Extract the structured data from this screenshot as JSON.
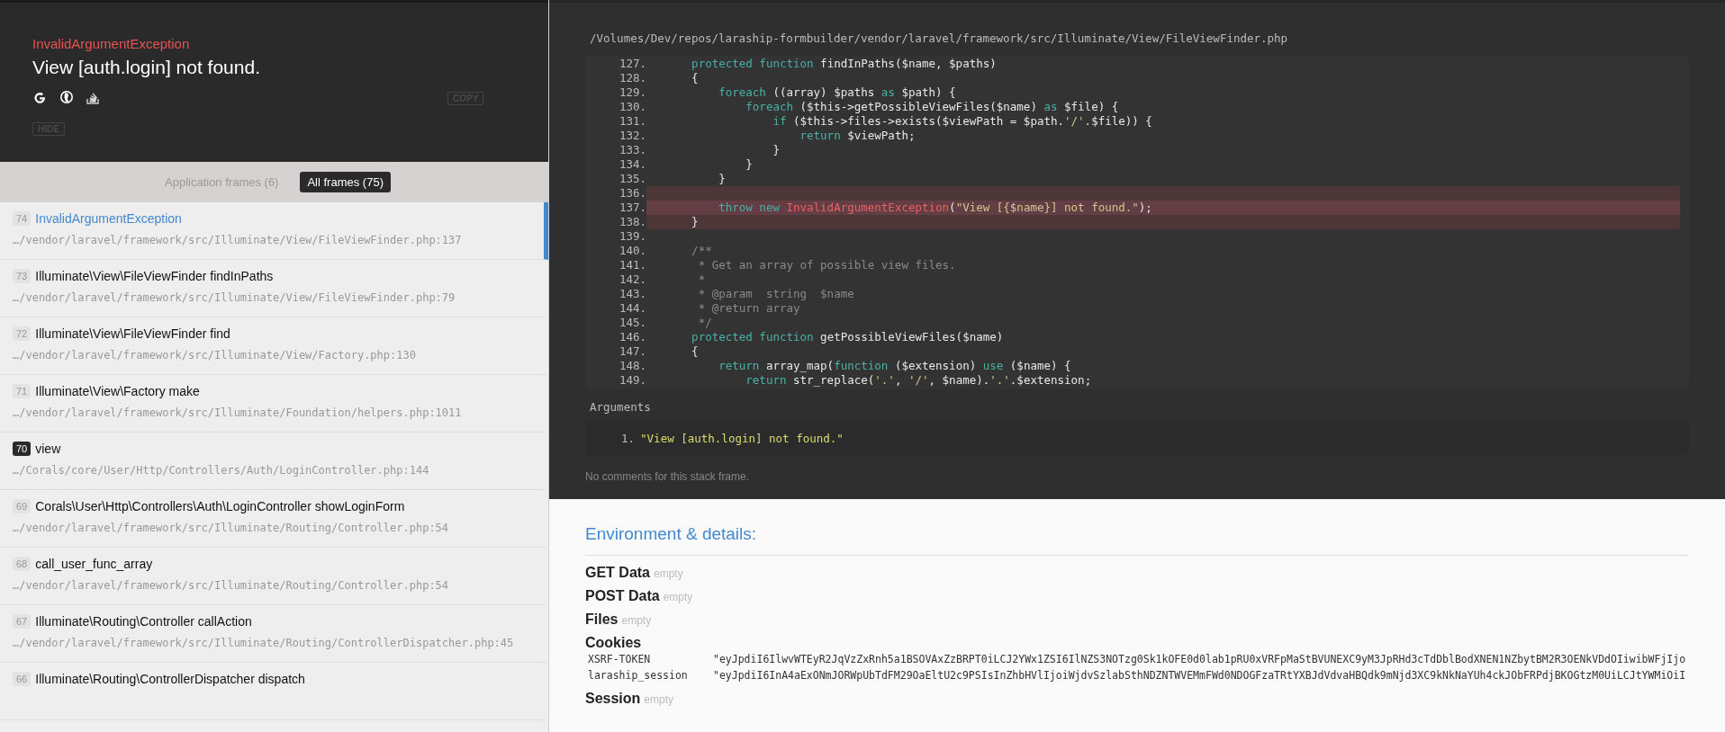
{
  "header": {
    "exception_class": "InvalidArgumentException",
    "message": "View [auth.login] not found.",
    "copy_button": "COPY",
    "hide_button": "HIDE"
  },
  "frame_tabs": [
    {
      "label": "Application frames (6)",
      "selected": false
    },
    {
      "label": "All frames (75)",
      "selected": true
    }
  ],
  "frames": [
    {
      "number": "74",
      "title": "InvalidArgumentException",
      "path": "…/vendor/laravel/framework/src/Illuminate/View/FileViewFinder.php:137",
      "selected": true,
      "application": false
    },
    {
      "number": "73",
      "title": "Illuminate\\View\\FileViewFinder findInPaths",
      "path": "…/vendor/laravel/framework/src/Illuminate/View/FileViewFinder.php:79",
      "selected": false,
      "application": false
    },
    {
      "number": "72",
      "title": "Illuminate\\View\\FileViewFinder find",
      "path": "…/vendor/laravel/framework/src/Illuminate/View/Factory.php:130",
      "selected": false,
      "application": false
    },
    {
      "number": "71",
      "title": "Illuminate\\View\\Factory make",
      "path": "…/vendor/laravel/framework/src/Illuminate/Foundation/helpers.php:1011",
      "selected": false,
      "application": false
    },
    {
      "number": "70",
      "title": "view",
      "path": "…/Corals/core/User/Http/Controllers/Auth/LoginController.php:144",
      "selected": false,
      "application": true
    },
    {
      "number": "69",
      "title": "Corals\\User\\Http\\Controllers\\Auth\\LoginController showLoginForm",
      "path": "…/vendor/laravel/framework/src/Illuminate/Routing/Controller.php:54",
      "selected": false,
      "application": false
    },
    {
      "number": "68",
      "title": "call_user_func_array",
      "path": "…/vendor/laravel/framework/src/Illuminate/Routing/Controller.php:54",
      "selected": false,
      "application": false
    },
    {
      "number": "67",
      "title": "Illuminate\\Routing\\Controller callAction",
      "path": "…/vendor/laravel/framework/src/Illuminate/Routing/ControllerDispatcher.php:45",
      "selected": false,
      "application": false
    },
    {
      "number": "66",
      "title": "Illuminate\\Routing\\ControllerDispatcher dispatch",
      "selected": false,
      "application": false
    }
  ],
  "code": {
    "file_path": "/Volumes/Dev/repos/laraship-formbuilder/vendor/laravel/framework/src/Illuminate/View/FileViewFinder.php",
    "lines": [
      {
        "number": "127.",
        "highlighted": false,
        "error": false,
        "tokens": [
          {
            "kind": "keyword",
            "text": "    protected function"
          },
          {
            "kind": "plain",
            "text": " findInPaths($name, $paths)"
          }
        ]
      },
      {
        "number": "128.",
        "highlighted": false,
        "error": false,
        "tokens": [
          {
            "kind": "plain",
            "text": "    {"
          }
        ]
      },
      {
        "number": "129.",
        "highlighted": false,
        "error": false,
        "tokens": [
          {
            "kind": "keyword",
            "text": "        foreach"
          },
          {
            "kind": "plain",
            "text": " ((array) $paths "
          },
          {
            "kind": "keyword",
            "text": "as"
          },
          {
            "kind": "plain",
            "text": " $path) {"
          }
        ]
      },
      {
        "number": "130.",
        "highlighted": false,
        "error": false,
        "tokens": [
          {
            "kind": "keyword",
            "text": "            foreach"
          },
          {
            "kind": "plain",
            "text": " ($this->getPossibleViewFiles($name) "
          },
          {
            "kind": "keyword",
            "text": "as"
          },
          {
            "kind": "plain",
            "text": " $file) {"
          }
        ]
      },
      {
        "number": "131.",
        "highlighted": false,
        "error": false,
        "tokens": [
          {
            "kind": "keyword",
            "text": "                if"
          },
          {
            "kind": "plain",
            "text": " ($this->files->exists($viewPath = $path."
          },
          {
            "kind": "string",
            "text": "'/'"
          },
          {
            "kind": "plain",
            "text": ".$file)) {"
          }
        ]
      },
      {
        "number": "132.",
        "highlighted": false,
        "error": false,
        "tokens": [
          {
            "kind": "keyword",
            "text": "                    return"
          },
          {
            "kind": "plain",
            "text": " $viewPath;"
          }
        ]
      },
      {
        "number": "133.",
        "highlighted": false,
        "error": false,
        "tokens": [
          {
            "kind": "plain",
            "text": "                }"
          }
        ]
      },
      {
        "number": "134.",
        "highlighted": false,
        "error": false,
        "tokens": [
          {
            "kind": "plain",
            "text": "            }"
          }
        ]
      },
      {
        "number": "135.",
        "highlighted": false,
        "error": false,
        "tokens": [
          {
            "kind": "plain",
            "text": "        }"
          }
        ]
      },
      {
        "number": "136.",
        "highlighted": true,
        "error": false
      },
      {
        "number": "137.",
        "highlighted": true,
        "error": true,
        "tokens": [
          {
            "kind": "keyword",
            "text": "        throw new "
          },
          {
            "kind": "class",
            "text": "InvalidArgumentException"
          },
          {
            "kind": "plain",
            "text": "("
          },
          {
            "kind": "string",
            "text": "\"View [{$name}] not found.\""
          },
          {
            "kind": "plain",
            "text": ");"
          }
        ]
      },
      {
        "number": "138.",
        "highlighted": true,
        "error": false,
        "tokens": [
          {
            "kind": "plain",
            "text": "    }"
          }
        ]
      },
      {
        "number": "139.",
        "highlighted": false,
        "error": false
      },
      {
        "number": "140.",
        "highlighted": false,
        "error": false,
        "tokens": [
          {
            "kind": "comment",
            "text": "    /**"
          }
        ]
      },
      {
        "number": "141.",
        "highlighted": false,
        "error": false,
        "tokens": [
          {
            "kind": "comment",
            "text": "     * Get an array of possible view files."
          }
        ]
      },
      {
        "number": "142.",
        "highlighted": false,
        "error": false,
        "tokens": [
          {
            "kind": "comment",
            "text": "     *"
          }
        ]
      },
      {
        "number": "143.",
        "highlighted": false,
        "error": false,
        "tokens": [
          {
            "kind": "comment",
            "text": "     * @param  string  $name"
          }
        ]
      },
      {
        "number": "144.",
        "highlighted": false,
        "error": false,
        "tokens": [
          {
            "kind": "comment",
            "text": "     * @return array"
          }
        ]
      },
      {
        "number": "145.",
        "highlighted": false,
        "error": false,
        "tokens": [
          {
            "kind": "comment",
            "text": "     */"
          }
        ]
      },
      {
        "number": "146.",
        "highlighted": false,
        "error": false,
        "tokens": [
          {
            "kind": "keyword",
            "text": "    protected function"
          },
          {
            "kind": "plain",
            "text": " getPossibleViewFiles($name)"
          }
        ]
      },
      {
        "number": "147.",
        "highlighted": false,
        "error": false,
        "tokens": [
          {
            "kind": "plain",
            "text": "    {"
          }
        ]
      },
      {
        "number": "148.",
        "highlighted": false,
        "error": false,
        "tokens": [
          {
            "kind": "keyword",
            "text": "        return"
          },
          {
            "kind": "plain",
            "text": " array_map("
          },
          {
            "kind": "keyword",
            "text": "function"
          },
          {
            "kind": "plain",
            "text": " ($extension) "
          },
          {
            "kind": "keyword",
            "text": "use"
          },
          {
            "kind": "plain",
            "text": " ($name) {"
          }
        ]
      },
      {
        "number": "149.",
        "highlighted": false,
        "error": false,
        "tokens": [
          {
            "kind": "keyword",
            "text": "            return"
          },
          {
            "kind": "plain",
            "text": " str_replace("
          },
          {
            "kind": "string",
            "text": "'.'"
          },
          {
            "kind": "plain",
            "text": ", "
          },
          {
            "kind": "string",
            "text": "'/'"
          },
          {
            "kind": "plain",
            "text": ", $name)."
          },
          {
            "kind": "string",
            "text": "'.'"
          },
          {
            "kind": "plain",
            "text": ".$extension;"
          }
        ]
      }
    ]
  },
  "arguments": {
    "label": "Arguments",
    "items": [
      {
        "number": "1.",
        "value": "\"View [auth.login] not found.\""
      }
    ]
  },
  "comments_note": "No comments for this stack frame.",
  "environment": {
    "title": "Environment & details:",
    "sections": [
      {
        "title": "GET Data",
        "empty_label": "empty"
      },
      {
        "title": "POST Data",
        "empty_label": "empty"
      },
      {
        "title": "Files",
        "empty_label": "empty"
      },
      {
        "title": "Cookies",
        "rows": [
          {
            "key": "XSRF-TOKEN",
            "value": "\"eyJpdiI6IlwvWTEyR2JqVzZxRnh5a1BSOVAxZzBRPT0iLCJ2YWx1ZSI6IlNZS3NOTzg0Sk1kOFE0d0lab1pRU0xVRFpMaStBVUNEXC9yM3JpRHd3cTdDblBodXNEN1NZbytBM2R3OENkVDdOIiwibWFjIjo"
          },
          {
            "key": "laraship_session",
            "value": "\"eyJpdiI6InA4aExONmJORWpUbTdFM29OaEltU2c9PSIsInZhbHVlIjoiWjdvSzlabSthNDZNTWVEMmFWd0NDOGFzaTRtYXBJdVdvaHBQdk9mNjd3XC9kNkNaYUh4ckJObFRPdjBKOGtzM0UiLCJtYWMiOiI"
          }
        ]
      },
      {
        "title": "Session",
        "empty_label": "empty"
      }
    ]
  }
}
